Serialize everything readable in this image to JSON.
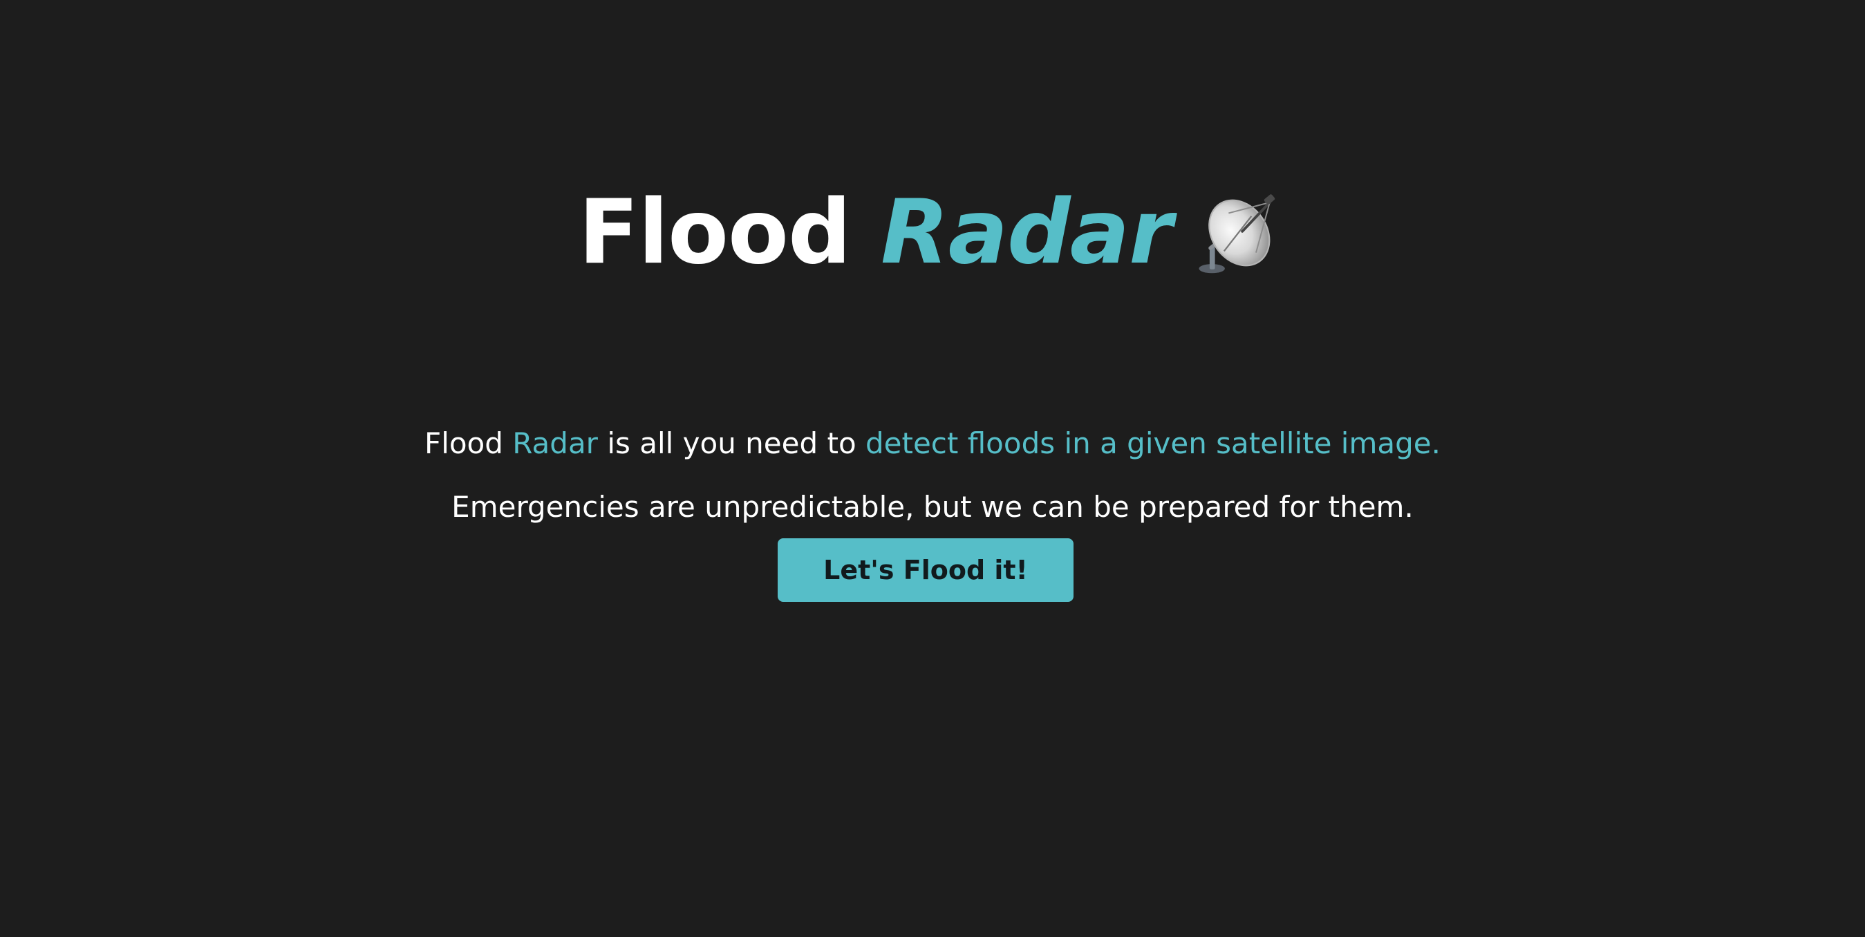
{
  "header": {
    "title_part1": "Flood",
    "title_part2": "Radar",
    "icon": "satellite-dish-icon"
  },
  "intro": {
    "line1": {
      "seg1": "Flood",
      "seg2": "Radar",
      "seg3": "is all you need to",
      "seg4": "detect floods in a given satellite image."
    },
    "line2": "Emergencies are unpredictable, but we can be prepared for them."
  },
  "cta": {
    "label": "Let's Flood it!"
  },
  "colors": {
    "background": "#1d1d1d",
    "accent": "#56bec8",
    "text": "#ffffff",
    "button_text": "#111a1d"
  }
}
